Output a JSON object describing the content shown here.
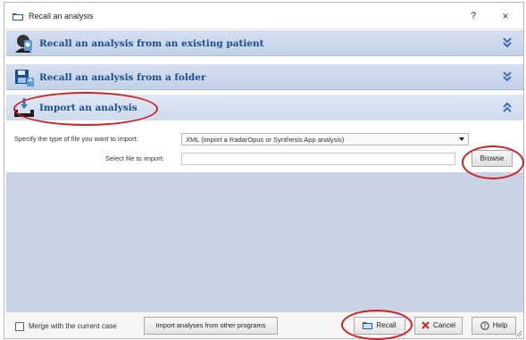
{
  "window": {
    "title": "Recall an analysis",
    "help_glyph": "?",
    "close_glyph": "×"
  },
  "sections": [
    {
      "label": "Recall an analysis from an existing patient",
      "icon": "patient-icon",
      "state": "collapsed"
    },
    {
      "label": "Recall an analysis from a folder",
      "icon": "folder-save-icon",
      "state": "collapsed"
    },
    {
      "label": "Import an analysis",
      "icon": "import-tray-icon",
      "state": "expanded"
    }
  ],
  "import_panel": {
    "file_type_label": "Specify the type of file you want to import:",
    "file_type_value": "XML (import a RadarOpus or Synthesis App analysis)",
    "select_file_label": "Select file to import:",
    "select_file_value": "",
    "browse_label": "Browse"
  },
  "footer": {
    "merge_label": "Merge with the current case",
    "merge_checked": false,
    "import_other_label": "Import analyses from other programs",
    "recall_label": "Recall",
    "cancel_label": "Cancel",
    "help_label": "Help"
  },
  "colors": {
    "section_text": "#1a4f8a",
    "section_bg": "#c8d6ec",
    "empty_area_bg": "#c8d3e6",
    "annotation": "#d21f1f",
    "chevron": "#3d6fb0"
  }
}
